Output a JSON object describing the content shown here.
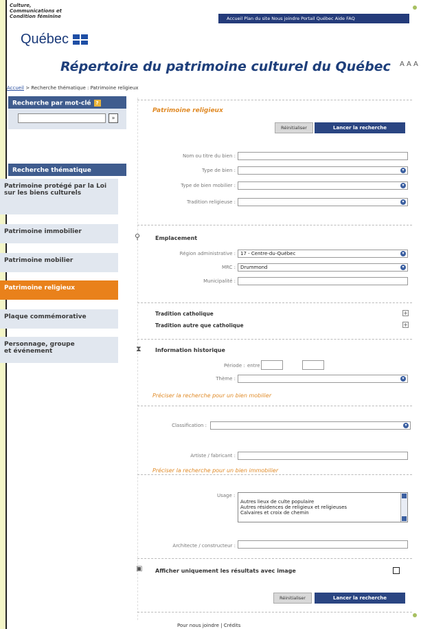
{
  "header": {
    "ministry_lines": [
      "Culture,",
      "Communications et",
      "Condition féminine"
    ],
    "brand": "Québec",
    "topnav": "Accueil  Plan du site  Nous joindre  Portail Québec  Aide  FAQ",
    "site_title": "Répertoire du patrimoine culturel du Québec",
    "font_size_control": "A A A"
  },
  "breadcrumb": {
    "home": "Accueil",
    "trail": " > Recherche thématique  :  Patrimoine religieux"
  },
  "sidebar": {
    "keyword_title": "Recherche par mot-clé",
    "keyword_input_value": "",
    "keyword_go": "»",
    "thematic_title": "Recherche thématique",
    "items": [
      {
        "label": "Patrimoine protégé par la Loi sur les biens culturels"
      },
      {
        "label": "Patrimoine immobilier"
      },
      {
        "label": "Patrimoine mobilier"
      },
      {
        "label": "Patrimoine religieux"
      },
      {
        "label": "Plaque commémorative"
      },
      {
        "label": "Personnage, groupe et événement"
      }
    ]
  },
  "form": {
    "section_title": "Patrimoine religieux",
    "reset_label": "Réinitialiser",
    "search_label": "Lancer la recherche",
    "fields": {
      "name_label": "Nom ou titre du bien :",
      "type_label": "Type de bien :",
      "type_mobilier_label": "Type de bien mobilier :",
      "tradition_label": "Tradition religieuse :"
    },
    "location": {
      "title": "Emplacement",
      "region_label": "Région administrative :",
      "region_value": "17 - Centre-du-Québec",
      "mrc_label": "MRC :",
      "mrc_value": "Drummond",
      "municipality_label": "Municipalité :"
    },
    "traditions": {
      "catholic": "Tradition catholique",
      "other": "Tradition autre que catholique"
    },
    "history": {
      "title": "Information historique",
      "period_label": "Période :",
      "period_between": "entre",
      "theme_label": "Thème :"
    },
    "mobilier": {
      "title": "Préciser la recherche pour un bien mobilier",
      "classification_label": "Classification :",
      "artist_label": "Artiste / fabricant :"
    },
    "immobilier": {
      "title": "Préciser la recherche pour un bien immobilier",
      "usage_label": "Usage :",
      "usage_options": [
        "Autres lieux de culte populaire",
        "Autres résidences de religieux et religieuses",
        "Calvaires et croix de chemin"
      ],
      "architect_label": "Architecte / constructeur :"
    },
    "images_only_label": "Afficher uniquement les résultats avec image"
  },
  "footer": {
    "links": "Pour nous joindre  |  Crédits"
  },
  "colors": {
    "navy": "#2a4582",
    "orange": "#e9811b",
    "sidebar_bg": "#e1e7ef",
    "page_bg": "#f4f6c8"
  }
}
